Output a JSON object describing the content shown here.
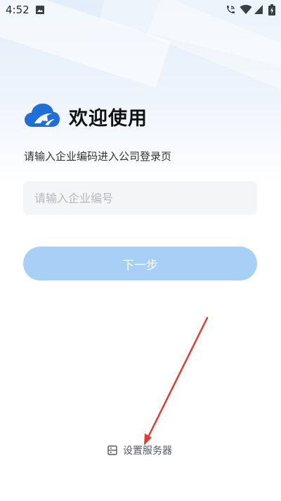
{
  "status_bar": {
    "time": "4:52",
    "icons": [
      "image-icon",
      "wifi-calling-icon",
      "wifi-icon",
      "signal-icon",
      "battery-charging-icon"
    ]
  },
  "header": {
    "logo_icon": "cloud-logo-icon",
    "title": "欢迎使用",
    "subtitle": "请输入企业编码进入公司登录页"
  },
  "form": {
    "company_code_placeholder": "请输入企业编号",
    "company_code_value": "",
    "next_label": "下一步"
  },
  "footer": {
    "server_icon": "server-settings-icon",
    "server_label": "设置服务器"
  },
  "colors": {
    "accent": "#a8cff6",
    "logo": "#1f6fd6",
    "annotation_arrow": "#e53935"
  }
}
